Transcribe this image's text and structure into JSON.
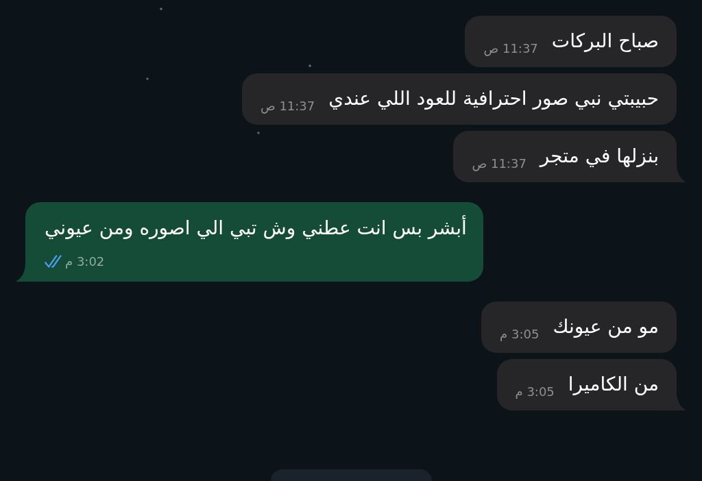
{
  "messages": [
    {
      "kind": "received",
      "text": "صباح البركات",
      "time": "11:37 ص",
      "tail": false
    },
    {
      "kind": "received",
      "text": "حبيبتي نبي صور احترافية للعود اللي عندي",
      "time": "11:37 ص",
      "tail": false
    },
    {
      "kind": "received",
      "text": "بنزلها في متجر",
      "time": "11:37 ص",
      "tail": true
    },
    {
      "kind": "sent",
      "text": "أبشر بس انت عطني وش تبي الي اصوره ومن عيوني",
      "time": "3:02 م",
      "read": true,
      "tail": true
    },
    {
      "kind": "received",
      "text": "مو من عيونك",
      "time": "3:05 م",
      "tail": false
    },
    {
      "kind": "received",
      "text": "من الكاميرا",
      "time": "3:05 م",
      "tail": true
    }
  ],
  "date_separator": {
    "shown": true
  }
}
